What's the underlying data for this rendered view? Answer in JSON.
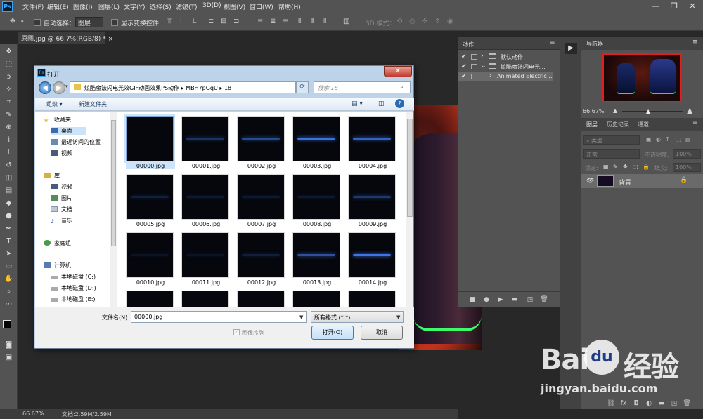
{
  "app": {
    "logo": "Ps"
  },
  "menu": [
    "文件(F)",
    "编辑(E)",
    "图像(I)",
    "图层(L)",
    "文字(Y)",
    "选择(S)",
    "滤镜(T)",
    "3D(D)",
    "视图(V)",
    "窗口(W)",
    "帮助(H)"
  ],
  "window_controls": {
    "minimize": "—",
    "restore": "❐",
    "close": "✕"
  },
  "options": {
    "auto_select_label": "自动选择：",
    "auto_select_value": "图层",
    "show_transform_label": "显示变换控件",
    "mode_3d_label": "3D 模式："
  },
  "document_tab": {
    "title": "原图.jpg @ 66.7%(RGB/8) *",
    "close": "×"
  },
  "status": {
    "zoom": "66.67%",
    "doc_info": "文档:2.59M/2.59M"
  },
  "actions_panel": {
    "title": "动作",
    "rows": [
      {
        "label": "默认动作"
      },
      {
        "label": "炫酷魔法闪电光..."
      },
      {
        "label": "Animated Electric ..."
      }
    ]
  },
  "navigator": {
    "title": "导航器",
    "zoom": "66.67%"
  },
  "layers_panel": {
    "tabs": [
      "图层",
      "历史记录",
      "通道"
    ],
    "kind_filter": "类型",
    "blend_mode": "正常",
    "opacity_label": "不透明度:",
    "opacity_value": "100%",
    "lock_label": "锁定:",
    "fill_label": "填充:",
    "fill_value": "100%",
    "layer_name": "背景"
  },
  "dialog": {
    "title": "打开",
    "close": "✕",
    "path": "炫酷魔法闪电光效GIF动画效果PS动作 ▸ MBH7pGqU ▸ 18",
    "search_placeholder": "搜索 18",
    "organize": "组织 ▾",
    "new_folder": "新建文件夹",
    "help": "?",
    "sidebar": [
      {
        "label": "收藏夹",
        "icon": "star-icon"
      },
      {
        "label": "桌面",
        "icon": "desktop-icon"
      },
      {
        "label": "最近访问的位置",
        "icon": "recent-icon"
      },
      {
        "label": "视频",
        "icon": "video-icon"
      },
      {
        "label": "库",
        "icon": "library-icon"
      },
      {
        "label": "视频",
        "icon": "video-icon"
      },
      {
        "label": "图片",
        "icon": "pictures-icon"
      },
      {
        "label": "文档",
        "icon": "documents-icon"
      },
      {
        "label": "音乐",
        "icon": "music-icon"
      },
      {
        "label": "家庭组",
        "icon": "homegroup-icon"
      },
      {
        "label": "计算机",
        "icon": "computer-icon"
      },
      {
        "label": "本地磁盘 (C:)",
        "icon": "disk-icon"
      },
      {
        "label": "本地磁盘 (D:)",
        "icon": "disk-icon"
      },
      {
        "label": "本地磁盘 (E:)",
        "icon": "disk-icon"
      }
    ],
    "files": [
      "00000.jpg",
      "00001.jpg",
      "00002.jpg",
      "00003.jpg",
      "00004.jpg",
      "00005.jpg",
      "00006.jpg",
      "00007.jpg",
      "00008.jpg",
      "00009.jpg",
      "00010.jpg",
      "00011.jpg",
      "00012.jpg",
      "00013.jpg",
      "00014.jpg",
      "",
      "",
      "",
      "",
      ""
    ],
    "filename_label": "文件名(N):",
    "filename_value": "00000.jpg",
    "filetype_value": "所有格式 (*.*)",
    "image_sequence_label": "图像序列",
    "open_button": "打开(O)",
    "cancel_button": "取消"
  },
  "watermark": {
    "brand_left": "Bai",
    "brand_paw": "du",
    "brand_right": "经验",
    "url": "jingyan.baidu.com"
  }
}
